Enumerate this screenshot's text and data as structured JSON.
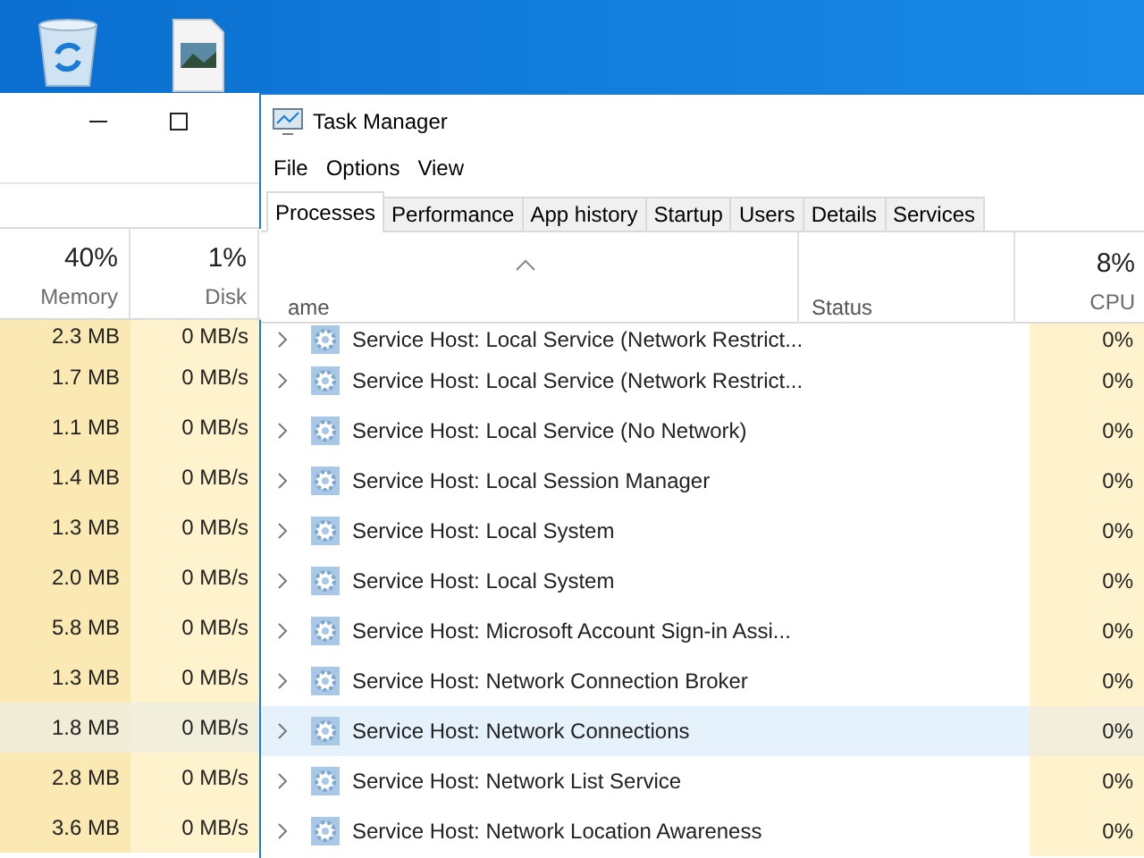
{
  "back_window": {
    "columns": [
      {
        "percent": "40%",
        "label": "Memory"
      },
      {
        "percent": "1%",
        "label": "Disk"
      }
    ],
    "rows": [
      {
        "memory": "2.3 MB",
        "disk": "0 MB/s",
        "selected": false
      },
      {
        "memory": "1.7 MB",
        "disk": "0 MB/s",
        "selected": false
      },
      {
        "memory": "1.1 MB",
        "disk": "0 MB/s",
        "selected": false
      },
      {
        "memory": "1.4 MB",
        "disk": "0 MB/s",
        "selected": false
      },
      {
        "memory": "1.3 MB",
        "disk": "0 MB/s",
        "selected": false
      },
      {
        "memory": "2.0 MB",
        "disk": "0 MB/s",
        "selected": false
      },
      {
        "memory": "5.8 MB",
        "disk": "0 MB/s",
        "selected": false
      },
      {
        "memory": "1.3 MB",
        "disk": "0 MB/s",
        "selected": false
      },
      {
        "memory": "1.8 MB",
        "disk": "0 MB/s",
        "selected": true
      },
      {
        "memory": "2.8 MB",
        "disk": "0 MB/s",
        "selected": false
      },
      {
        "memory": "3.6 MB",
        "disk": "0 MB/s",
        "selected": false
      }
    ]
  },
  "task_manager": {
    "title": "Task Manager",
    "menu": [
      "File",
      "Options",
      "View"
    ],
    "tabs": [
      {
        "label": "Processes",
        "selected": true
      },
      {
        "label": "Performance",
        "selected": false
      },
      {
        "label": "App history",
        "selected": false
      },
      {
        "label": "Startup",
        "selected": false
      },
      {
        "label": "Users",
        "selected": false
      },
      {
        "label": "Details",
        "selected": false
      },
      {
        "label": "Services",
        "selected": false
      }
    ],
    "columns": {
      "name": "ame",
      "status": "Status",
      "cpu_percent": "8%",
      "cpu": "CPU"
    },
    "rows": [
      {
        "name": "Service Host: Local Service (Network Restrict...",
        "cpu": "0%",
        "selected": false
      },
      {
        "name": "Service Host: Local Service (Network Restrict...",
        "cpu": "0%",
        "selected": false
      },
      {
        "name": "Service Host: Local Service (No Network)",
        "cpu": "0%",
        "selected": false
      },
      {
        "name": "Service Host: Local Session Manager",
        "cpu": "0%",
        "selected": false
      },
      {
        "name": "Service Host: Local System",
        "cpu": "0%",
        "selected": false
      },
      {
        "name": "Service Host: Local System",
        "cpu": "0%",
        "selected": false
      },
      {
        "name": "Service Host: Microsoft Account Sign-in Assi...",
        "cpu": "0%",
        "selected": false
      },
      {
        "name": "Service Host: Network Connection Broker",
        "cpu": "0%",
        "selected": false
      },
      {
        "name": "Service Host: Network Connections",
        "cpu": "0%",
        "selected": true
      },
      {
        "name": "Service Host: Network List Service",
        "cpu": "0%",
        "selected": false
      },
      {
        "name": "Service Host: Network Location Awareness",
        "cpu": "0%",
        "selected": false
      }
    ]
  }
}
